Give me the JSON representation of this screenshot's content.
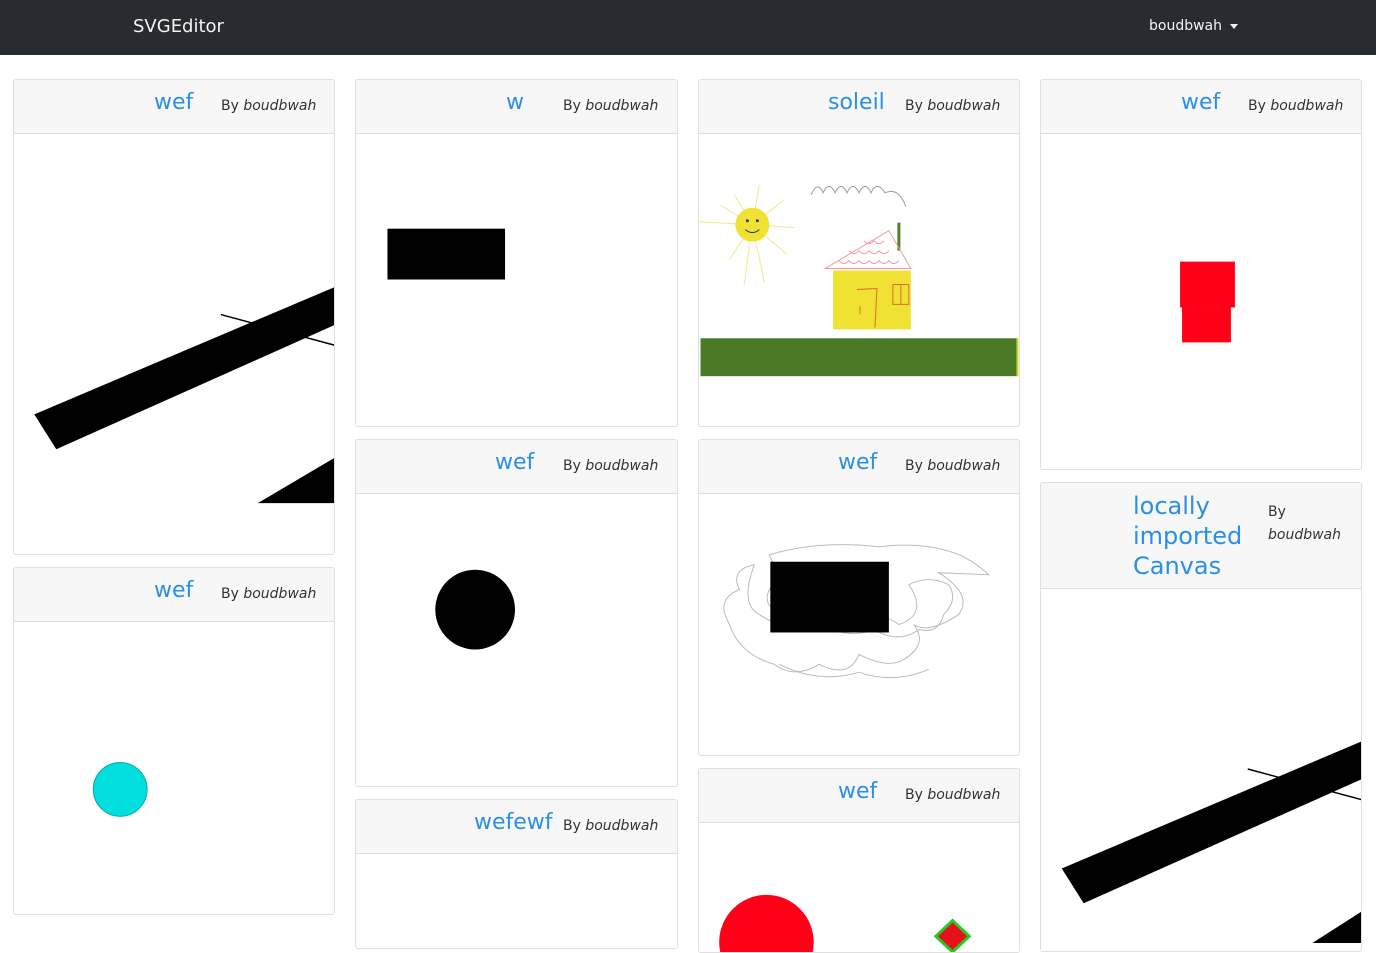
{
  "navbar": {
    "brand": "SVGEditor",
    "user": "boudbwah"
  },
  "colors": {
    "navbar_bg": "#282c31",
    "link": "#2b8fe6",
    "card_header_bg": "#f7f7f7"
  },
  "cards": [
    {
      "title": "wef",
      "by_label": "By",
      "author": "boudbwah"
    },
    {
      "title": "wef",
      "by_label": "By",
      "author": "boudbwah"
    },
    {
      "title": "w",
      "by_label": "By",
      "author": "boudbwah"
    },
    {
      "title": "wef",
      "by_label": "By",
      "author": "boudbwah"
    },
    {
      "title": "wefewf",
      "by_label": "By",
      "author": "boudbwah"
    },
    {
      "title": "soleil",
      "by_label": "By",
      "author": "boudbwah"
    },
    {
      "title": "wef",
      "by_label": "By",
      "author": "boudbwah"
    },
    {
      "title": "wef",
      "by_label": "By",
      "author": "boudbwah"
    },
    {
      "title": "wef",
      "by_label": "By",
      "author": "boudbwah"
    },
    {
      "title_lines": [
        "locally",
        "imported",
        "Canvas"
      ],
      "by_label": "By",
      "author": "boudbwah"
    }
  ]
}
